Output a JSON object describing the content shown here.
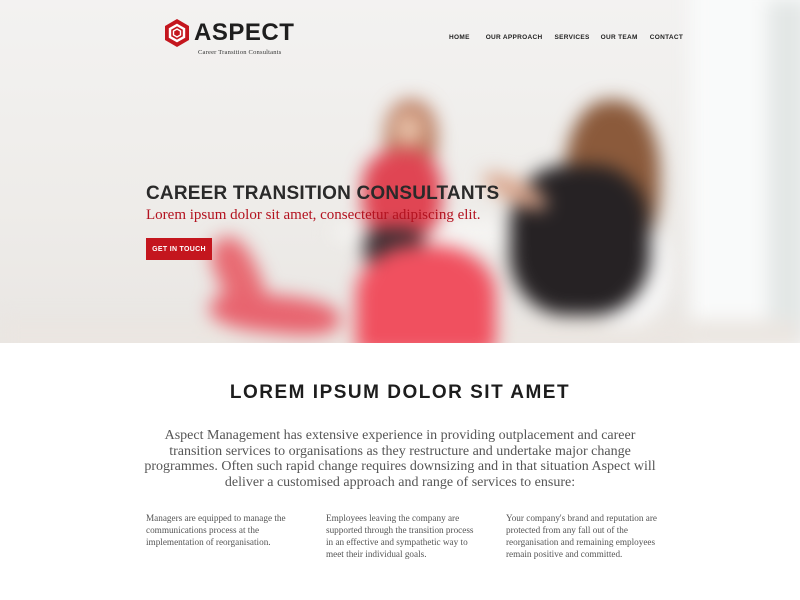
{
  "brand": {
    "name": "ASPECT",
    "tagline": "Career Transition Consultants",
    "accent_color": "#c4161e",
    "logo_icon": "hexagon-logo-icon"
  },
  "nav": {
    "items": [
      "HOME",
      "OUR APPROACH",
      "SERVICES",
      "OUR TEAM",
      "CONTACT"
    ]
  },
  "hero": {
    "title": "CAREER TRANSITION CONSULTANTS",
    "subtitle": "Lorem ipsum dolor sit amet, consectetur adipiscing elit.",
    "cta_label": "GET IN TOUCH"
  },
  "main": {
    "section_title": "LOREM IPSUM DOLOR SIT AMET",
    "intro": "Aspect Management has extensive experience in providing outplacement and career transition services to organisations as they restructure and undertake major change programmes. Often such rapid change requires downsizing and in that situation Aspect will deliver a customised approach and range of services to ensure:",
    "columns": [
      "Managers are equipped to manage the communications process at the implementation of reorganisation.",
      "Employees leaving the company are supported through the transition process in an effective and sympathetic way to meet their individual goals.",
      "Your company's brand and reputation are protected from any fall out of the reorganisation and remaining employees remain positive and committed."
    ]
  }
}
